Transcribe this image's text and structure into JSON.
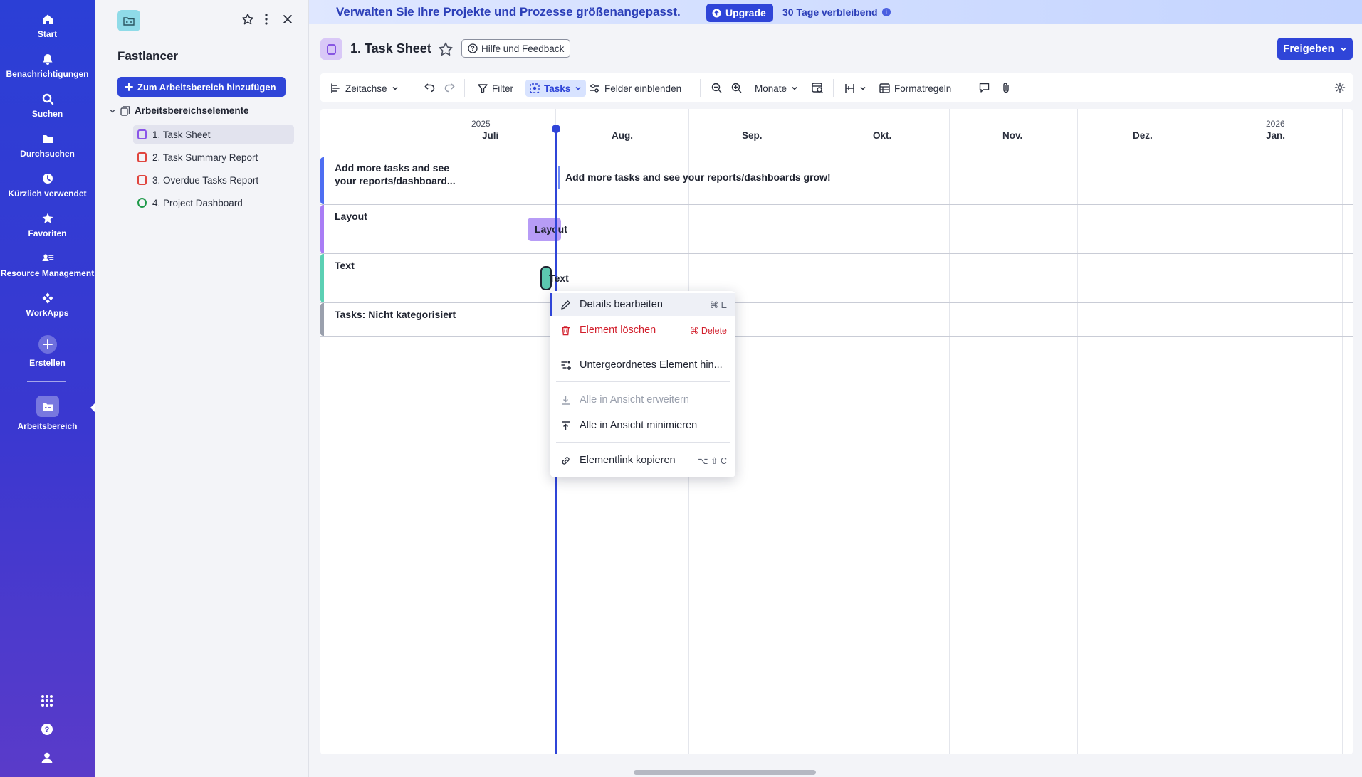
{
  "rail": {
    "items": [
      {
        "label": "Start",
        "icon": "home-icon"
      },
      {
        "label": "Benachrichtigungen",
        "icon": "bell-icon"
      },
      {
        "label": "Suchen",
        "icon": "search-icon"
      },
      {
        "label": "Durchsuchen",
        "icon": "folder-icon"
      },
      {
        "label": "Kürzlich verwendet",
        "icon": "clock-icon"
      },
      {
        "label": "Favoriten",
        "icon": "star-icon"
      },
      {
        "label": "Resource Management",
        "icon": "people-icon"
      },
      {
        "label": "WorkApps",
        "icon": "workapps-icon"
      },
      {
        "label": "Erstellen",
        "icon": "plus-icon"
      },
      {
        "label": "Arbeitsbereich",
        "icon": "workspace-icon"
      }
    ]
  },
  "panel": {
    "title": "Fastlancer",
    "add_button": "Zum Arbeitsbereich hinzufügen",
    "group_label": "Arbeitsbereichselemente",
    "items": [
      {
        "label": "1. Task Sheet",
        "type": "sheet"
      },
      {
        "label": "2. Task Summary Report",
        "type": "report"
      },
      {
        "label": "3. Overdue Tasks Report",
        "type": "report"
      },
      {
        "label": "4. Project Dashboard",
        "type": "dashboard"
      }
    ]
  },
  "banner": {
    "text": "Verwalten Sie Ihre Projekte und Prozesse größenangepasst.",
    "upgrade": "Upgrade",
    "trial": "30 Tage verbleibend"
  },
  "sheet": {
    "title": "1. Task Sheet",
    "help": "Hilfe und Feedback",
    "share": "Freigeben"
  },
  "toolbar": {
    "view": "Zeitachse",
    "filter": "Filter",
    "tasks": "Tasks",
    "show_fields": "Felder einblenden",
    "zoom_unit": "Monate",
    "format_rules": "Formatregeln"
  },
  "timeline": {
    "years": [
      "2025",
      "2026"
    ],
    "months": [
      "Juli",
      "Aug.",
      "Sep.",
      "Okt.",
      "Nov.",
      "Dez.",
      "Jan."
    ],
    "rows": [
      {
        "name": "Add more tasks and see your reports/dashboard...",
        "color": "#4e6ef2"
      },
      {
        "name": "Layout",
        "color": "#a97df5"
      },
      {
        "name": "Text",
        "color": "#5cd0b4"
      },
      {
        "name": "Tasks: Nicht kategorisiert",
        "color": "#9aa0ad"
      }
    ],
    "bars": {
      "row1": "Add more tasks and see your reports/dashboards grow!",
      "row2": "Layout",
      "row3": "Text"
    }
  },
  "context_menu": {
    "items": [
      {
        "label": "Details bearbeiten",
        "shortcut": "⌘ E"
      },
      {
        "label": "Element löschen",
        "shortcut": "⌘ Delete"
      },
      {
        "label": "Untergeordnetes Element hin..."
      },
      {
        "label": "Alle in Ansicht erweitern"
      },
      {
        "label": "Alle in Ansicht minimieren"
      },
      {
        "label": "Elementlink kopieren",
        "shortcut": "⌥ ⇧ C"
      }
    ]
  },
  "colors": {
    "primary": "#2f45d8",
    "danger": "#d21f2c"
  }
}
